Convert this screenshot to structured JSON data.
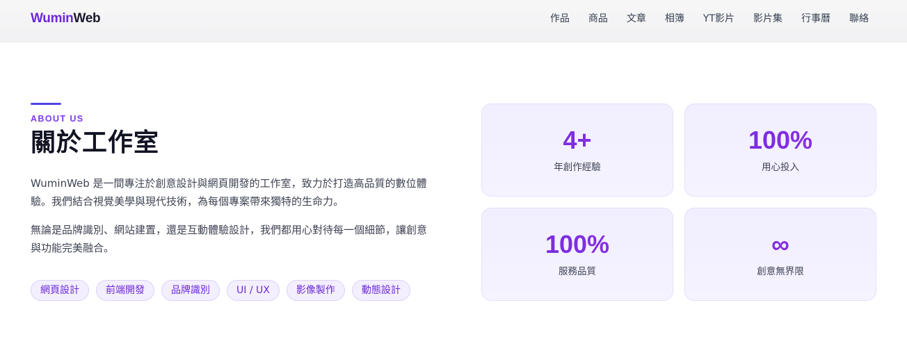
{
  "header": {
    "logo_part1": "Wumin",
    "logo_part2": "Web",
    "nav": [
      "作品",
      "商品",
      "文章",
      "相簿",
      "YT影片",
      "影片集",
      "行事曆",
      "聯絡"
    ]
  },
  "about": {
    "eyebrow": "ABOUT US",
    "title": "關於工作室",
    "paragraph1": "WuminWeb 是一間專注於創意設計與網頁開發的工作室，致力於打造高品質的數位體驗。我們結合視覺美學與現代技術，為每個專案帶來獨特的生命力。",
    "paragraph2": "無論是品牌識別、網站建置，還是互動體驗設計，我們都用心對待每一個細節，讓創意與功能完美融合。",
    "tags": [
      "網頁設計",
      "前端開發",
      "品牌識別",
      "UI / UX",
      "影像製作",
      "動態設計"
    ]
  },
  "stats": [
    {
      "value": "4+",
      "label": "年創作經驗"
    },
    {
      "value": "100%",
      "label": "用心投入"
    },
    {
      "value": "100%",
      "label": "服務品質"
    },
    {
      "value": "∞",
      "label": "創意無界限"
    }
  ],
  "colors": {
    "accent": "#6d28d9",
    "accent_bar": "#4f46e5",
    "card_bg": "#f3f1ff",
    "tag_bg": "#f3efff"
  }
}
